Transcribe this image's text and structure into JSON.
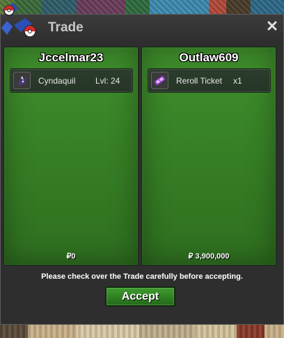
{
  "window": {
    "title": "Trade",
    "close_icon": "close-icon"
  },
  "left_panel": {
    "player_name": "Jccelmar23",
    "item": {
      "icon": "pokemon-sprite-icon",
      "name": "Cyndaquil",
      "extra": "Lvl: 24"
    },
    "money": "₽0"
  },
  "right_panel": {
    "player_name": "Outlaw609",
    "item": {
      "icon": "ticket-icon",
      "name": "Reroll Ticket",
      "extra": "x1"
    },
    "money": "₽ 3,900,000"
  },
  "notice": "Please check over the Trade carefully before accepting.",
  "accept_label": "Accept",
  "colors": {
    "panel_green": "#3f8f2c",
    "window_bg": "#2e2e2e",
    "accept_green": "#3f9b2e"
  }
}
